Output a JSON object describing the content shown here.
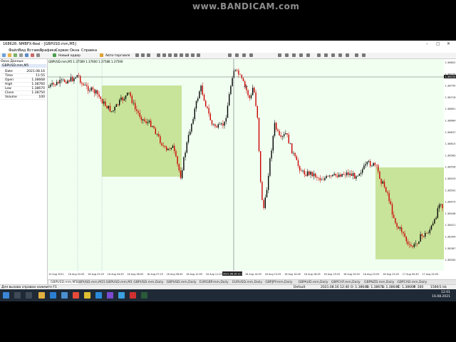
{
  "watermark": "www.BANDICAM.com",
  "window": {
    "title": "168628: NMBFX-Real - [GBPUSD.mm,M5]"
  },
  "menu": [
    "Файл",
    "Вид",
    "Вставка",
    "Графики",
    "Сервис",
    "Окна",
    "Справка"
  ],
  "toolbar": {
    "new_order": "Новый ордер",
    "autotrading": "Авто-торговля"
  },
  "data_window": {
    "title": "Окно Данных",
    "symbol": "GBPUSD.mm,M5",
    "rows": [
      {
        "k": "Date",
        "v": "2021.08.16"
      },
      {
        "k": "Time",
        "v": "11:55"
      },
      {
        "k": "Open",
        "v": "1.38668"
      },
      {
        "k": "High",
        "v": "1.38760"
      },
      {
        "k": "Low",
        "v": "1.38670"
      },
      {
        "k": "Close",
        "v": "1.38750"
      },
      {
        "k": "Volume",
        "v": "100"
      }
    ]
  },
  "chart_header": "GBPUSD.mm,M5  1.37589 1.37600 1.37588 1.37590",
  "price_axis": [
    "1.38802",
    "1.38770",
    "1.38745",
    "1.38718",
    "1.38691",
    "1.38664",
    "1.38637",
    "1.38610",
    "1.38583",
    "1.38556",
    "1.38529",
    "1.38502",
    "1.38475",
    "1.38448",
    "1.38421",
    "1.38394",
    "1.38367",
    "1.38340"
  ],
  "current_price": "1.38725",
  "time_axis": [
    "13 Aug 2021",
    "16 Aug 02:05",
    "16 Aug 03:25",
    "16 Aug 04:45",
    "16 Aug 06:05",
    "16 Aug 07:25",
    "16 Aug 08:45",
    "16 Aug 10:05",
    "16 Aug 11:25",
    "16 Aug 12:45",
    "16 Aug 14:05",
    "16 Aug 15:25",
    "16 Aug 16:45",
    "16 Aug 18:05",
    "16 Aug 19:25",
    "16 Aug 20:45",
    "16 Aug 22:05",
    "16 Aug 23:25",
    "17 Aug 00:45",
    "17 Aug 02:05"
  ],
  "time_cursor": "2021.08.16 11:55",
  "tabs": [
    "GBPUSD.mm,M5",
    "GBPUSD.mm,M15",
    "GBPUSD.mm,M1",
    "GBPUSD.mm,Daily",
    "GBPUSD.mm,Daily",
    "EURGBP.mm,Daily",
    "EURUSD.mm,Daily",
    "GBPJPY.mm,Daily",
    "GBPAUD.mm,Daily",
    "GBPCHF.mm,Daily",
    "GBPNZD.mm,Daily",
    "GBPCAD.mm,Daily"
  ],
  "status": {
    "help": "Для вызова справки нажмите F1",
    "profile": "Default",
    "datetime": "2021.08.16 12:40",
    "o": "O: 1.38645",
    "h": "H: 1.38674",
    "l": "L: 1.38640",
    "c": "C: 1.38664",
    "v": "V: 160",
    "traffic": "1580/1 kb"
  },
  "clock": {
    "time": "12:01",
    "date": "16.08.2021"
  },
  "colors": {
    "chart_bg": "#f0fff0",
    "bull": "#000000",
    "bear": "#cc0000",
    "zone": "#c8e39a"
  }
}
